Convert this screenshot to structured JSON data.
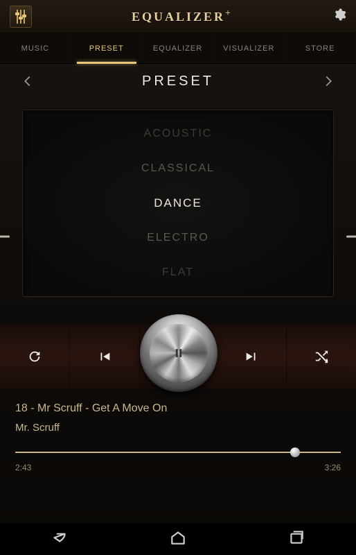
{
  "app_title_main": "EQUALIZER",
  "app_title_plus": "+",
  "tabs": [
    {
      "label": "MUSIC"
    },
    {
      "label": "PRESET"
    },
    {
      "label": "EQUALIZER"
    },
    {
      "label": "VISUALIZER"
    },
    {
      "label": "STORE"
    }
  ],
  "active_tab_index": 1,
  "section_title": "PRESET",
  "presets": [
    "ACOUSTIC",
    "CLASSICAL",
    "DANCE",
    "ELECTRO",
    "FLAT"
  ],
  "selected_preset_index": 2,
  "now_playing": {
    "track": "18 - Mr Scruff - Get A Move On",
    "artist": "Mr. Scruff",
    "elapsed": "2:43",
    "total": "3:26"
  },
  "progress_pct": 86
}
